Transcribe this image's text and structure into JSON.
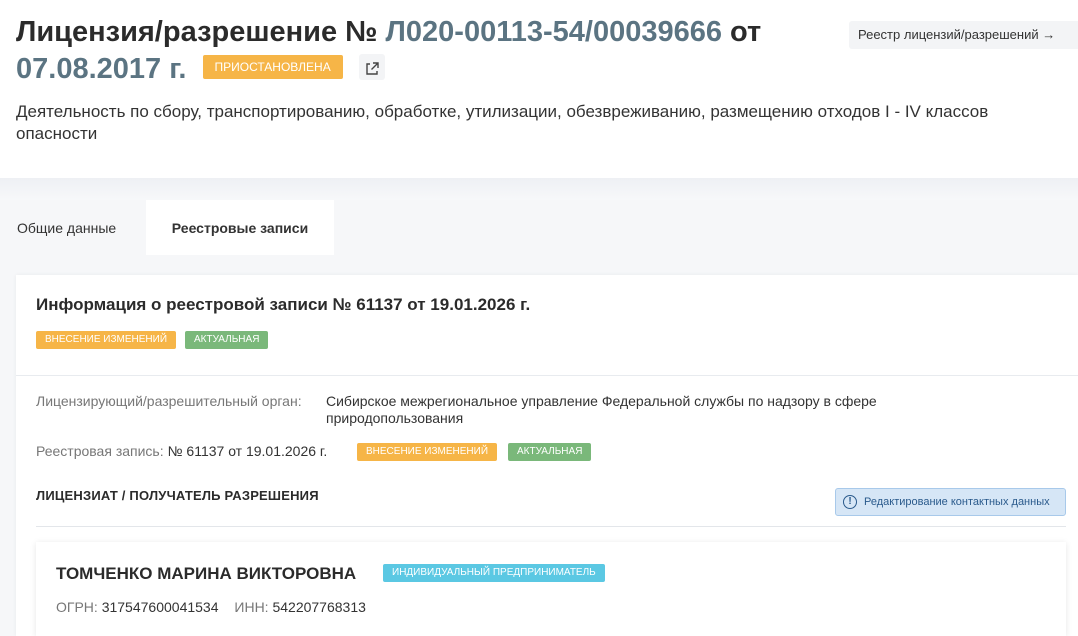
{
  "license": {
    "title_prefix": "Лицензия/разрешение № ",
    "number": "Л020-00113-54/00039666",
    "title_mid": " от",
    "date": "07.08.2017 г.",
    "status": "ПРИОСТАНОВЛЕНА",
    "activity": "Деятельность по сбору, транспортированию, обработке, утилизации, обезвреживанию, размещению отходов I - IV классов опасности"
  },
  "registry_button_label": "Реестр лицензий/разрешений →",
  "tabs": [
    {
      "label": "Общие данные"
    },
    {
      "label": "Реестровые записи"
    }
  ],
  "record": {
    "title": "Информация о реестровой записи № 61137 от 19.01.2026 г.",
    "tags": [
      "ВНЕСЕНИЕ ИЗМЕНЕНИЙ",
      "АКТУАЛЬНАЯ"
    ],
    "authority_label": "Лицензирующий/разрешительный орган:",
    "authority_value": "Сибирское межрегиональное управление Федеральной службы по надзору в сфере природопользования",
    "record_label": "Реестровая запись:",
    "record_value": "№ 61137 от 19.01.2026 г.",
    "section_title": "ЛИЦЕНЗИАТ / ПОЛУЧАТЕЛЬ РАЗРЕШЕНИЯ",
    "edit_contacts_label": "Редактирование контактных данных"
  },
  "licensee": {
    "name": "ТОМЧЕНКО МАРИНА ВИКТОРОВНА",
    "type": "ИНДИВИДУАЛЬНЫЙ ПРЕДПРИНИМАТЕЛЬ",
    "ogrn_label": "ОГРН:",
    "ogrn": "317547600041534",
    "inn_label": "ИНН:",
    "inn": "542207768313"
  },
  "colors": {
    "accent_orange": "#f6b547",
    "accent_green": "#7ab87a",
    "accent_blue": "#5bc8e3",
    "number_color": "#5b7482"
  }
}
